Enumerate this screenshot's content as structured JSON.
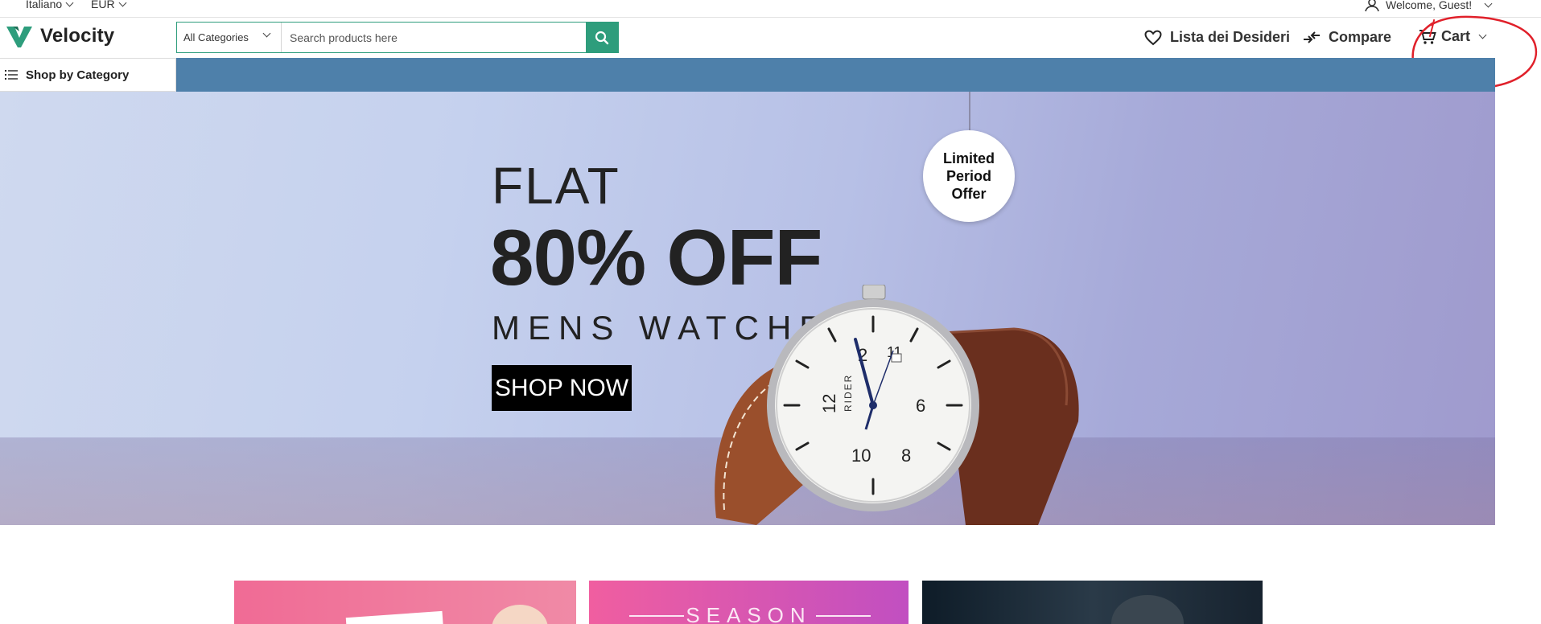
{
  "topbar": {
    "language": "Italiano",
    "currency": "EUR",
    "welcome": "Welcome, Guest!"
  },
  "header": {
    "logo_text": "Velocity",
    "category_select": "All Categories",
    "search_placeholder": "Search products here",
    "wishlist_label": "Lista dei Desideri",
    "compare_label": "Compare",
    "cart_label": "Cart"
  },
  "nav": {
    "shop_by_category": "Shop by Category"
  },
  "banner": {
    "line1": "FLAT",
    "line2": "80% OFF",
    "line3": "MENS WATCHES",
    "cta": "SHOP NOW",
    "tag_lines": [
      "Limited",
      "Period",
      "Offer"
    ],
    "watch_brand": "RIDER"
  },
  "promos": {
    "tile2_text": "SEASON"
  },
  "colors": {
    "accent": "#2e9d7c",
    "nav_bar": "#4e80aa",
    "annotation": "#e0202a"
  },
  "icons": {
    "search": "search-icon",
    "wishlist": "heart-icon",
    "compare": "compare-arrows-icon",
    "cart": "cart-icon",
    "account": "user-icon",
    "menu": "list-icon"
  }
}
